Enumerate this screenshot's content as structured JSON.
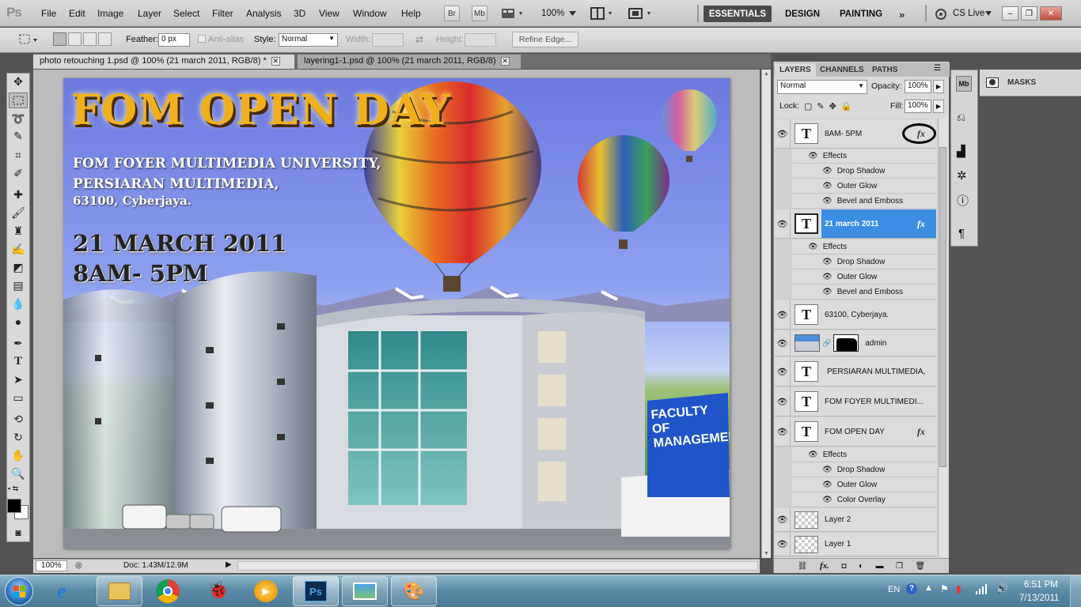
{
  "app": {
    "logo": "Ps"
  },
  "menu": [
    "File",
    "Edit",
    "Image",
    "Layer",
    "Select",
    "Filter",
    "Analysis",
    "3D",
    "View",
    "Window",
    "Help"
  ],
  "appbar": {
    "bridge": "Br",
    "minibridge": "Mb",
    "zoom": "100%"
  },
  "workspaces": [
    "ESSENTIALS",
    "DESIGN",
    "PAINTING"
  ],
  "cslive": "CS Live",
  "options": {
    "feather_label": "Feather:",
    "feather_value": "0 px",
    "antialias": "Anti-alias",
    "style_label": "Style:",
    "style_value": "Normal",
    "width_label": "Width:",
    "height_label": "Height:",
    "refine": "Refine Edge..."
  },
  "tabs": [
    "photo retouching 1.psd @ 100% (21 march 2011, RGB/8) *",
    "layering1-1.psd @ 100% (21 march 2011, RGB/8)"
  ],
  "poster": {
    "title": "FOM OPEN DAY",
    "line1": "FOM FOYER MULTIMEDIA UNIVERSITY,",
    "line2": "PERSIARAN MULTIMEDIA,",
    "line3": "63100, Cyberjaya.",
    "date": "21 MARCH 2011",
    "time": "8AM- 5PM",
    "sign": "FACULTY OF MANAGEMENT"
  },
  "status": {
    "zoom": "100%",
    "doc": "Doc: 1.43M/12.9M"
  },
  "panel": {
    "tabs": [
      "LAYERS",
      "CHANNELS",
      "PATHS"
    ],
    "blend": "Normal",
    "opacity_label": "Opacity:",
    "opacity": "100%",
    "lock_label": "Lock:",
    "fill_label": "Fill:",
    "fill": "100%",
    "effects_label": "Effects",
    "layers": [
      {
        "name": "8AM- 5PM",
        "effects": [
          "Drop Shadow",
          "Outer Glow",
          "Bevel and Emboss"
        ]
      },
      {
        "name": "21 march 2011",
        "effects": [
          "Drop Shadow",
          "Outer Glow",
          "Bevel and Emboss"
        ]
      },
      {
        "name": "63100, Cyberjaya."
      },
      {
        "name": "admin"
      },
      {
        "name": "PERSIARAN MULTIMEDIA,"
      },
      {
        "name": "FOM FOYER MULTIMEDI..."
      },
      {
        "name": "FOM OPEN DAY",
        "effects": [
          "Drop Shadow",
          "Outer Glow",
          "Color Overlay"
        ]
      },
      {
        "name": "Layer 2"
      },
      {
        "name": "Layer 1"
      }
    ]
  },
  "masks": "MASKS",
  "taskbar": {
    "lang": "EN",
    "time": "6:51 PM",
    "date": "7/13/2011"
  }
}
